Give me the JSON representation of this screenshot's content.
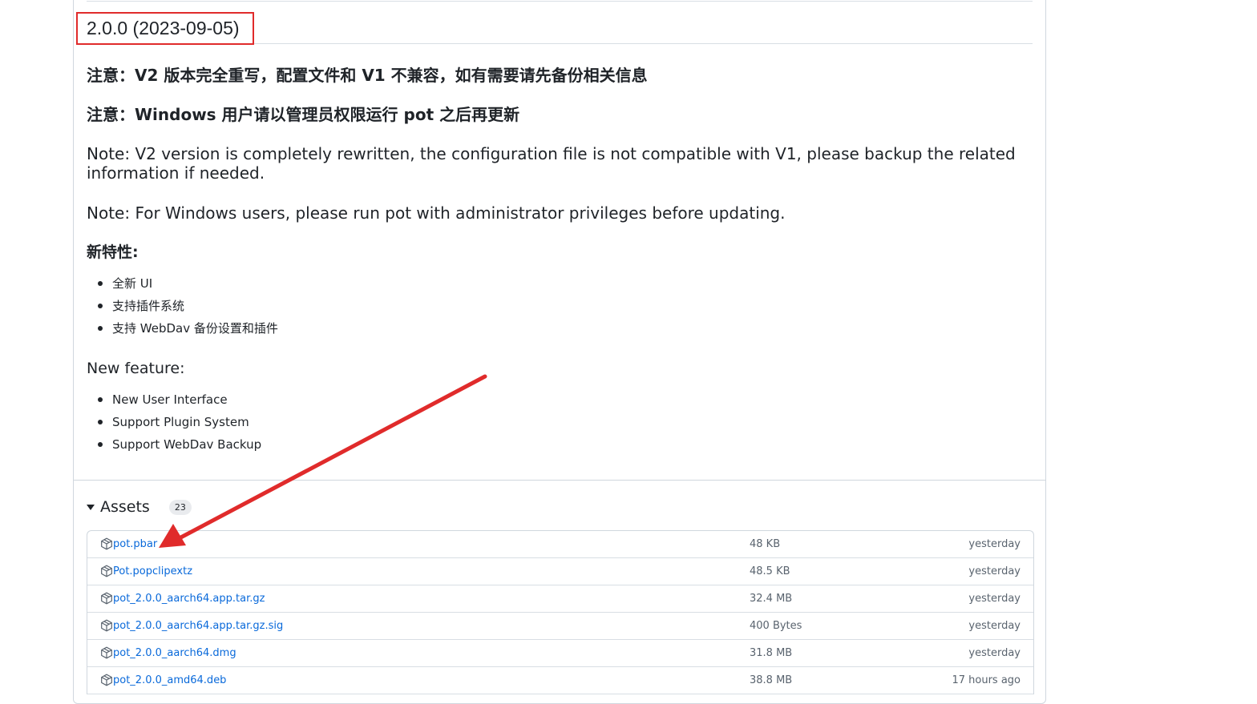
{
  "release": {
    "version_title": "2.0.0 (2023-09-05)",
    "notes": [
      "注意：V2 版本完全重写，配置文件和 V1 不兼容，如有需要请先备份相关信息",
      "注意：Windows 用户请以管理员权限运行 pot 之后再更新",
      "Note: V2 version is completely rewritten, the configuration file is not compatible with V1, please backup the related information if needed.",
      "Note: For Windows users, please run pot with administrator privileges before updating."
    ],
    "features_cn": {
      "heading": "新特性:",
      "items": [
        "全新 UI",
        "支持插件系统",
        "支持 WebDav 备份设置和插件"
      ]
    },
    "features_en": {
      "heading": "New feature:",
      "items": [
        "New User Interface",
        "Support Plugin System",
        "Support WebDav Backup"
      ]
    }
  },
  "assets": {
    "title": "Assets",
    "count": "23",
    "rows": [
      {
        "name": "pot.pbar",
        "size": "48 KB",
        "time": "yesterday"
      },
      {
        "name": "Pot.popclipextz",
        "size": "48.5 KB",
        "time": "yesterday"
      },
      {
        "name": "pot_2.0.0_aarch64.app.tar.gz",
        "size": "32.4 MB",
        "time": "yesterday"
      },
      {
        "name": "pot_2.0.0_aarch64.app.tar.gz.sig",
        "size": "400 Bytes",
        "time": "yesterday"
      },
      {
        "name": "pot_2.0.0_aarch64.dmg",
        "size": "31.8 MB",
        "time": "yesterday"
      },
      {
        "name": "pot_2.0.0_amd64.deb",
        "size": "38.8 MB",
        "time": "17 hours ago"
      }
    ]
  },
  "colors": {
    "annotation_red": "#e02b2b",
    "link_blue": "#0969da"
  },
  "icons": {
    "asset": "package-icon",
    "toggle": "caret-down-icon"
  }
}
